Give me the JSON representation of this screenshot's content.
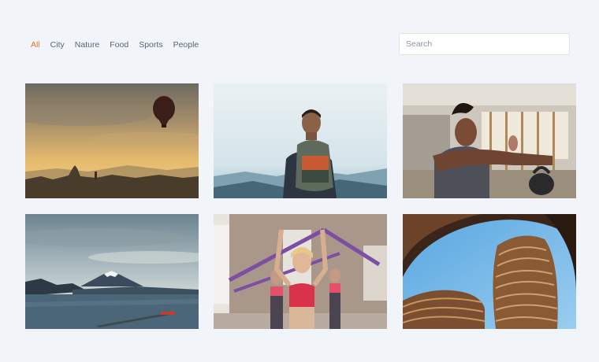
{
  "filters": {
    "items": [
      {
        "label": "All"
      },
      {
        "label": "City"
      },
      {
        "label": "Nature"
      },
      {
        "label": "Food"
      },
      {
        "label": "Sports"
      },
      {
        "label": "People"
      }
    ],
    "active": "All"
  },
  "search": {
    "placeholder": "Search",
    "value": ""
  },
  "gallery": {
    "images": [
      {
        "subject": "hot-air balloon over misty sunset temples"
      },
      {
        "subject": "hiker with backpack facing mountain lake"
      },
      {
        "subject": "man exercising with kettlebell in gym"
      },
      {
        "subject": "snow-capped mountain across lake"
      },
      {
        "subject": "women exercising with resistance bands"
      },
      {
        "subject": "circular modern building against blue sky"
      }
    ]
  },
  "colors": {
    "accent": "#e9712a",
    "background": "#f1f5f9",
    "text": "#5a6475"
  }
}
